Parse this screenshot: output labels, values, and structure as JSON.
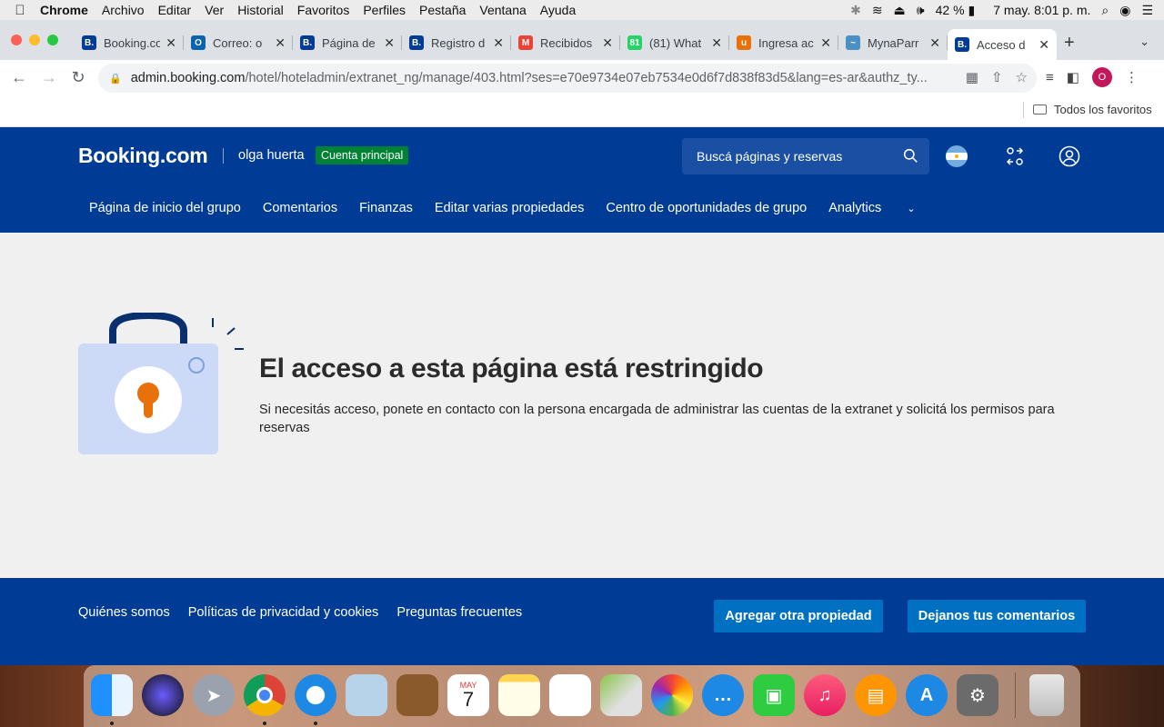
{
  "menubar": {
    "app": "Chrome",
    "items": [
      "Archivo",
      "Editar",
      "Ver",
      "Historial",
      "Favoritos",
      "Perfiles",
      "Pestaña",
      "Ventana",
      "Ayuda"
    ],
    "battery": "42 %",
    "datetime": "7 may.  8:01 p. m."
  },
  "tabs": [
    {
      "title": "Booking.com",
      "favicon": "B.",
      "color": "#003b95"
    },
    {
      "title": "Correo: o",
      "favicon": "O",
      "color": "#0a64ad"
    },
    {
      "title": "Página de",
      "favicon": "B.",
      "color": "#003b95"
    },
    {
      "title": "Registro d",
      "favicon": "B.",
      "color": "#003b95"
    },
    {
      "title": "Recibidos",
      "favicon": "M",
      "color": "#ea4335"
    },
    {
      "title": "(81) What",
      "favicon": "81",
      "color": "#25d366"
    },
    {
      "title": "Ingresa ac",
      "favicon": "u",
      "color": "#e8710a"
    },
    {
      "title": "MynaParr",
      "favicon": "~",
      "color": "#4a90c2"
    },
    {
      "title": "Acceso d",
      "favicon": "B.",
      "color": "#003b95"
    }
  ],
  "omnibox": {
    "domain": "admin.booking.com",
    "path": "/hotel/hoteladmin/extranet_ng/manage/403.html?ses=e70e9734e07eb7534e0d6f7d838f83d5&lang=es-ar&authz_ty..."
  },
  "profile_initial": "O",
  "bookmarks": {
    "all_label": "Todos los favoritos"
  },
  "booking": {
    "logo": "Booking.com",
    "user": "olga huerta",
    "badge": "Cuenta principal",
    "search_placeholder": "Buscá páginas y reservas",
    "nav": [
      "Página de inicio del grupo",
      "Comentarios",
      "Finanzas",
      "Editar varias propiedades",
      "Centro de oportunidades de grupo",
      "Analytics"
    ]
  },
  "error": {
    "title": "El acceso a esta página está restringido",
    "description": "Si necesitás acceso, ponete en contacto con la persona encargada de administrar las cuentas de la extranet y solicitá los permisos para reservas"
  },
  "footer": {
    "links": [
      "Quiénes somos",
      "Políticas de privacidad y cookies",
      "Preguntas frecuentes"
    ],
    "add_property": "Agregar otra propiedad",
    "feedback": "Dejanos tus comentarios"
  },
  "calendar": {
    "month": "MAY",
    "day": "7"
  },
  "colors": {
    "brand": "#003b95",
    "button": "#0071c2",
    "badge": "#008234",
    "lock": "#ccdaf7",
    "keyhole": "#e8710a"
  }
}
